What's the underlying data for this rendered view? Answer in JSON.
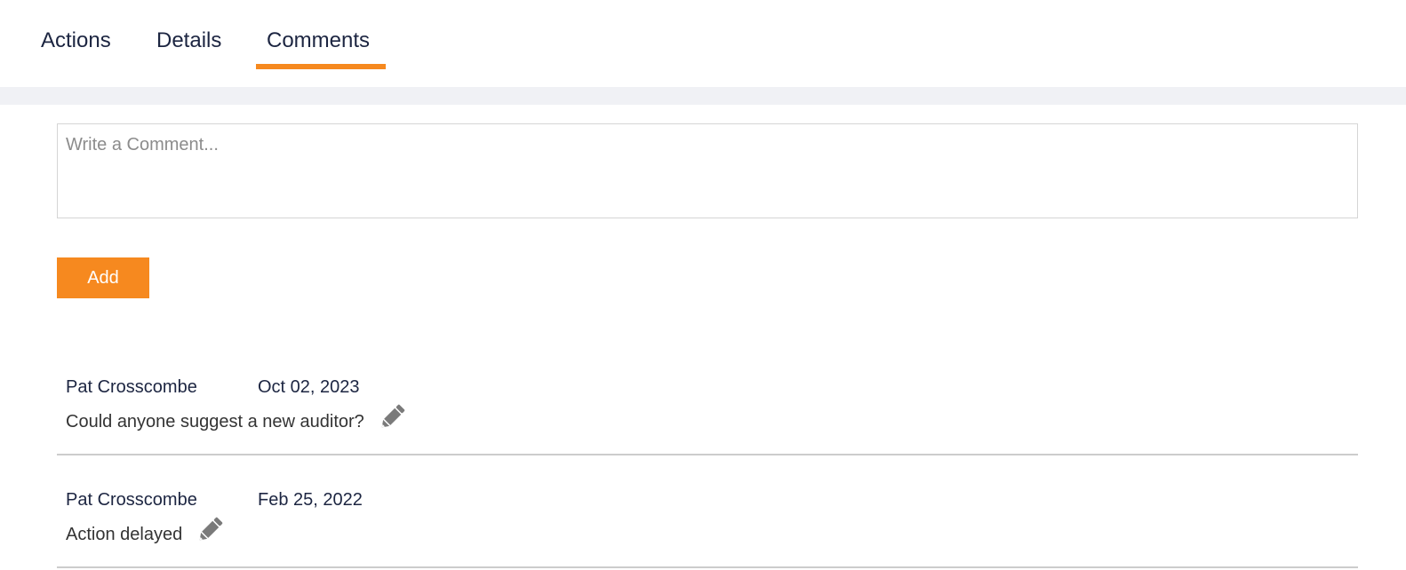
{
  "tabs": [
    {
      "label": "Actions",
      "active": false
    },
    {
      "label": "Details",
      "active": false
    },
    {
      "label": "Comments",
      "active": true
    }
  ],
  "comment_form": {
    "placeholder": "Write a Comment...",
    "value": "",
    "add_label": "Add"
  },
  "comments": [
    {
      "author": "Pat Crosscombe",
      "date": "Oct 02, 2023",
      "text": "Could anyone suggest a new auditor?",
      "icon": "pencil-icon"
    },
    {
      "author": "Pat Crosscombe",
      "date": "Feb 25, 2022",
      "text": "Action delayed",
      "icon": "pencil-icon"
    }
  ],
  "colors": {
    "accent": "#f6891f",
    "tab_text": "#1c2541",
    "band": "#f0f1f5",
    "divider": "#cccccc",
    "icon": "#7a7a7a"
  }
}
